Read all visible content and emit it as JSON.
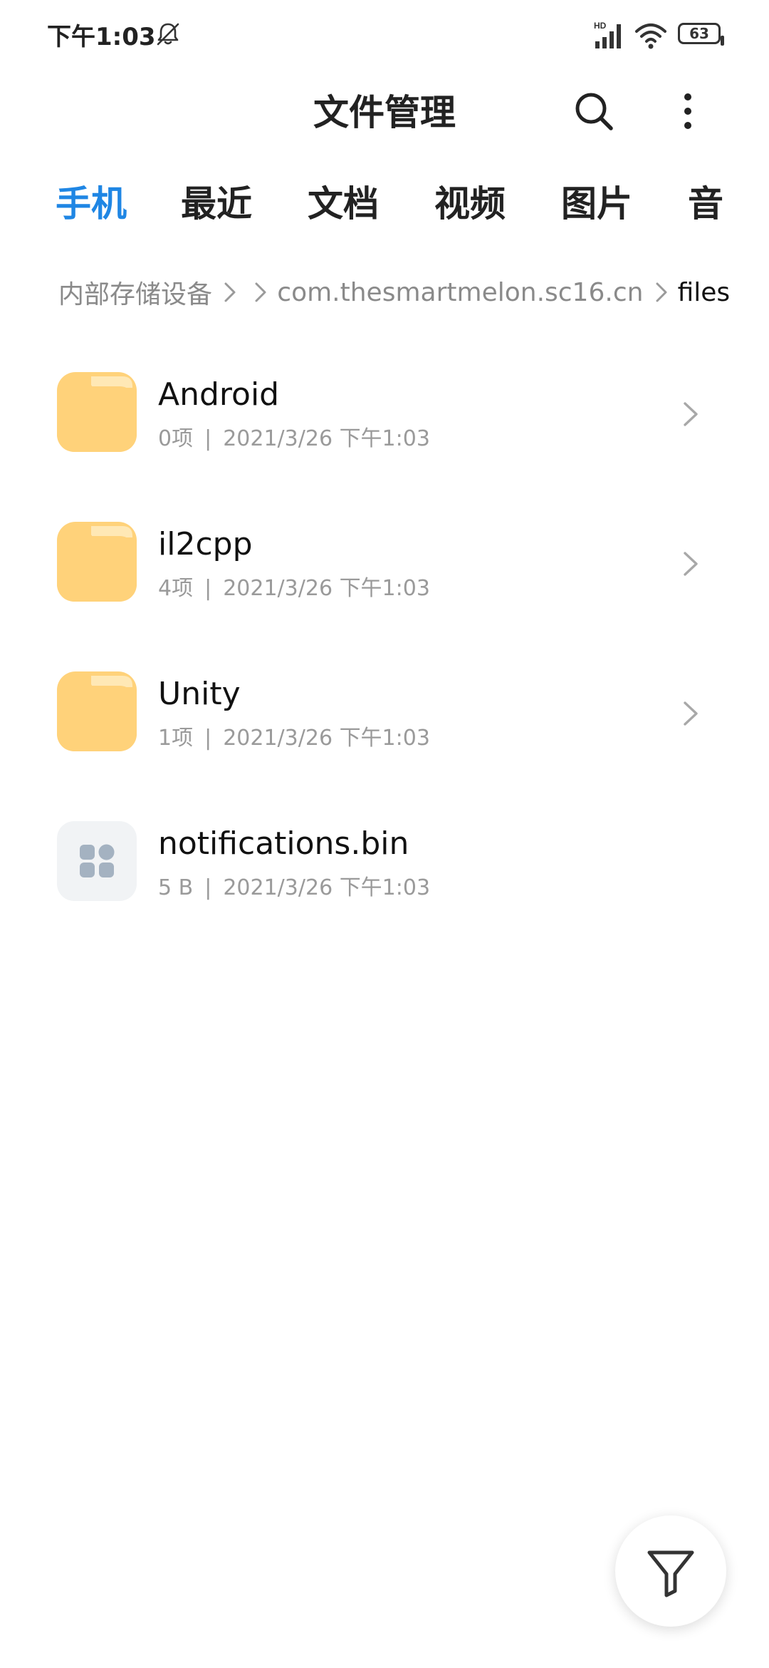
{
  "status_bar": {
    "time": "下午1:03",
    "network": "HD",
    "battery": "63"
  },
  "header": {
    "title": "文件管理"
  },
  "tabs": [
    {
      "label": "手机",
      "active": true
    },
    {
      "label": "最近",
      "active": false
    },
    {
      "label": "文档",
      "active": false
    },
    {
      "label": "视频",
      "active": false
    },
    {
      "label": "图片",
      "active": false
    },
    {
      "label": "音",
      "active": false
    }
  ],
  "breadcrumb": [
    {
      "label": "内部存储设备"
    },
    {
      "label": "com.thesmartmelon.sc16.cn"
    },
    {
      "label": "files"
    }
  ],
  "files": [
    {
      "name": "Android",
      "count": "0项",
      "date": "2021/3/26 下午1:03",
      "type": "folder"
    },
    {
      "name": "il2cpp",
      "count": "4项",
      "date": "2021/3/26 下午1:03",
      "type": "folder"
    },
    {
      "name": "Unity",
      "count": "1项",
      "date": "2021/3/26 下午1:03",
      "type": "folder"
    },
    {
      "name": "notifications.bin",
      "count": "5 B",
      "date": "2021/3/26 下午1:03",
      "type": "file"
    }
  ],
  "meta_separator": "|",
  "colors": {
    "accent": "#1f86e4",
    "folder": "#ffd27a",
    "folder_tab": "#ffe8b5"
  },
  "icons": {
    "search": "search-icon",
    "more": "more-vertical-icon",
    "filter": "filter-icon",
    "folder": "folder-icon",
    "file": "grid-file-icon"
  }
}
